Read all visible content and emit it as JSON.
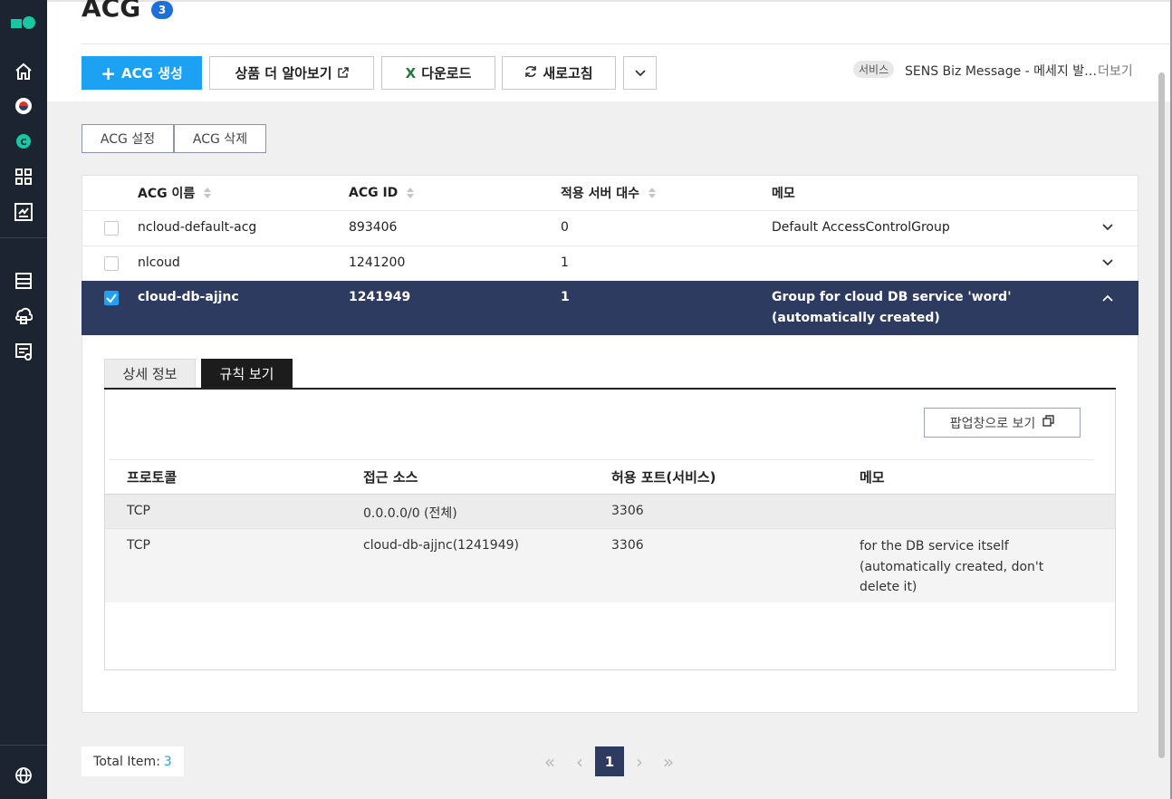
{
  "page": {
    "title": "ACG",
    "count_badge": "3"
  },
  "toolbar": {
    "create_label": "ACG 생성",
    "learn_more_label": "상품 더 알아보기",
    "download_label": "다운로드",
    "refresh_label": "새로고침"
  },
  "service_notice": {
    "tag": "서비스",
    "text": "SENS Biz Message - 메세지 발송 가능 국가 추가",
    "more": "더보기"
  },
  "actions": {
    "settings_label": "ACG 설정",
    "delete_label": "ACG 삭제"
  },
  "table": {
    "columns": [
      "ACG 이름",
      "ACG ID",
      "적용 서버 대수",
      "메모"
    ],
    "rows": [
      {
        "name": "ncloud-default-acg",
        "id": "893406",
        "servers": "0",
        "memo": "Default AccessControlGroup",
        "checked": false
      },
      {
        "name": "nlcoud",
        "id": "1241200",
        "servers": "1",
        "memo": "",
        "checked": false
      },
      {
        "name": "cloud-db-ajjnc",
        "id": "1241949",
        "servers": "1",
        "memo": "Group for cloud DB service 'word' (automatically created)",
        "checked": true
      }
    ]
  },
  "detail": {
    "tabs": [
      "상세 정보",
      "규칙 보기"
    ],
    "active_tab": "규칙 보기",
    "popup_label": "팝업창으로 보기",
    "rule_columns": [
      "프로토콜",
      "접근 소스",
      "허용 포트(서비스)",
      "메모"
    ],
    "rules": [
      {
        "protocol": "TCP",
        "source": "0.0.0.0/0 (전체)",
        "port": "3306",
        "memo": ""
      },
      {
        "protocol": "TCP",
        "source": "cloud-db-ajjnc(1241949)",
        "port": "3306",
        "memo": "for the DB service itself (automatically created, don't delete it)"
      }
    ]
  },
  "footer": {
    "total_label": "Total Item:",
    "total_value": "3",
    "current_page": "1"
  },
  "colors": {
    "primary": "#1da1f2",
    "selected_row": "#2e3b61",
    "sidebar": "#1c2331",
    "brand": "#17c8a4"
  },
  "icons": {
    "sidebar": [
      "home-icon",
      "korea-flag-icon",
      "c-circle-icon",
      "grid-icon",
      "dashboard-icon",
      "server-icon",
      "cloud-db-icon",
      "monitor-icon",
      "globe-icon"
    ],
    "toolbar": [
      "plus-icon",
      "external-link-icon",
      "excel-icon",
      "refresh-icon",
      "chevron-down-icon"
    ]
  }
}
